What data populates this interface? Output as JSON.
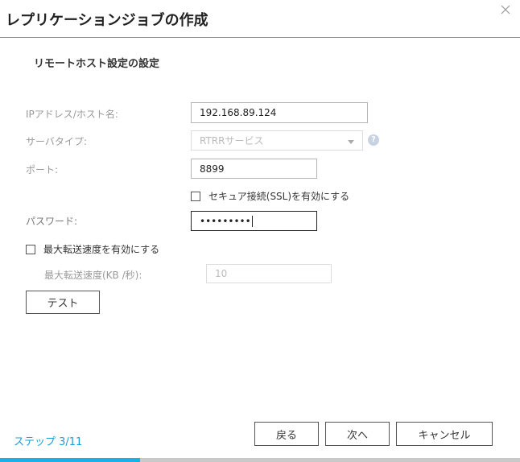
{
  "dialog": {
    "title": "レプリケーションジョブの作成",
    "section_title": "リモートホスト設定の設定"
  },
  "form": {
    "host": {
      "label": "IPアドレス/ホスト名:",
      "value": "192.168.89.124"
    },
    "server_type": {
      "label": "サーバタイプ:",
      "value": "RTRRサービス"
    },
    "port": {
      "label": "ポート:",
      "value": "8899"
    },
    "ssl": {
      "label": "セキュア接続(SSL)を有効にする",
      "checked": false
    },
    "password": {
      "label": "パスワード:",
      "value": "•••••••••"
    },
    "max_speed_enable": {
      "label": "最大転送速度を有効にする",
      "checked": false
    },
    "max_speed": {
      "label": "最大転送速度(KB /秒):",
      "value": "10"
    },
    "test_label": "テスト"
  },
  "footer": {
    "step_text": "ステップ 3/11",
    "back_label": "戻る",
    "next_label": "次へ",
    "cancel_label": "キャンセル",
    "progress": 0.27
  },
  "icons": {
    "close": "close-icon",
    "help": "help-icon",
    "dropdown": "chevron-down-icon"
  },
  "colors": {
    "accent": "#1bb0e6",
    "step_text": "#1a9ed8"
  }
}
